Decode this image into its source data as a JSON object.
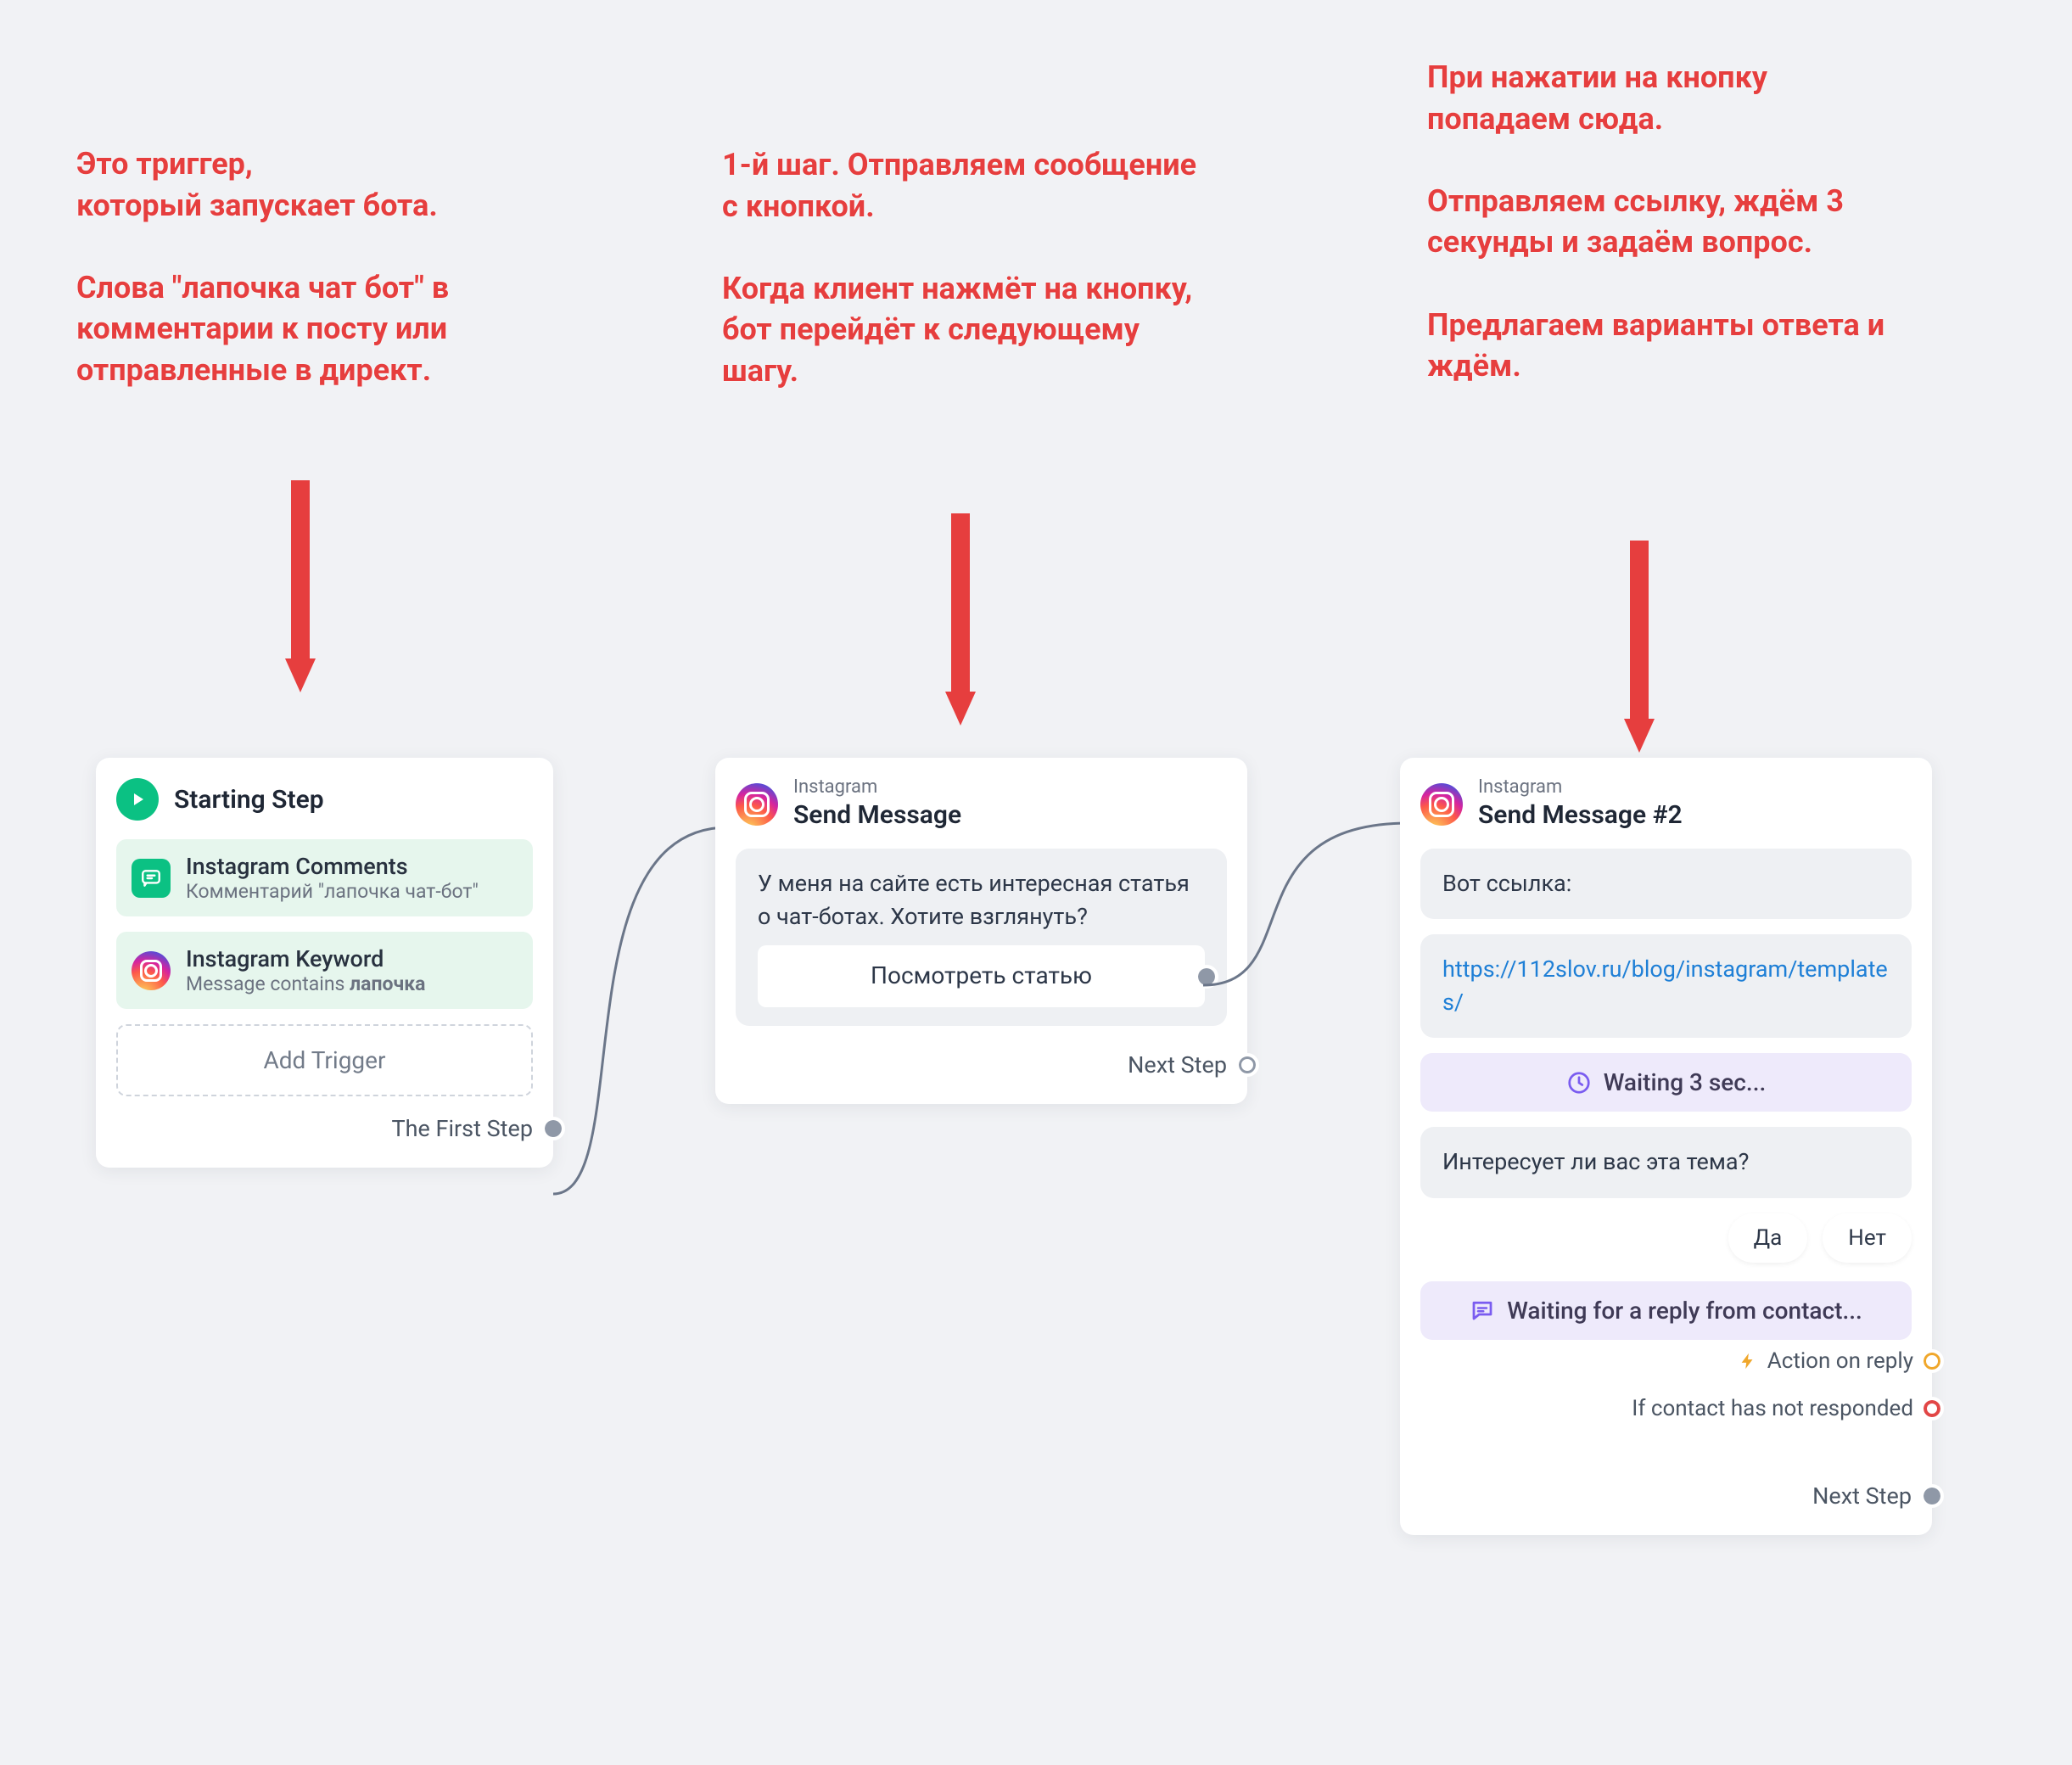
{
  "annotations": {
    "a1": "Это триггер,\nкоторый запускает бота.\n\nСлова \"лапочка чат бот\" в комментарии к посту или отправленные в директ.",
    "a2": "1-й шаг. Отправляем сообщение с кнопкой.\n\nКогда клиент нажмёт на кнопку, бот перейдёт к следующему шагу.",
    "a3": "При нажатии на кнопку попадаем сюда.\n\nОтправляем ссылку, ждём 3 секунды и задаём вопрос.\n\nПредлагаем варианты ответа и ждём."
  },
  "card1": {
    "title": "Starting Step",
    "trigger1": {
      "title": "Instagram Comments",
      "sub": "Комментарий \"лапочка чат-бот\""
    },
    "trigger2": {
      "title": "Instagram Keyword",
      "sub_prefix": "Message contains ",
      "sub_value": "лапочка"
    },
    "add_trigger": "Add Trigger",
    "port": "The First Step"
  },
  "card2": {
    "channel": "Instagram",
    "title": "Send Message",
    "message": "У меня на сайте есть интересная статья о чат-ботах. Хотите взглянуть?",
    "button_label": "Посмотреть статью",
    "port": "Next Step"
  },
  "card3": {
    "channel": "Instagram",
    "title": "Send Message #2",
    "msg1": "Вот ссылка:",
    "link": "https://112slov.ru/blog/instagram/templates/",
    "waiting": "Waiting 3 sec...",
    "msg2": "Интересует ли вас эта тема?",
    "reply_yes": "Да",
    "reply_no": "Нет",
    "waiting_reply": "Waiting for a reply from contact...",
    "outcome_reply": "Action on reply",
    "outcome_noresp": "If contact has not responded",
    "port": "Next Step"
  }
}
